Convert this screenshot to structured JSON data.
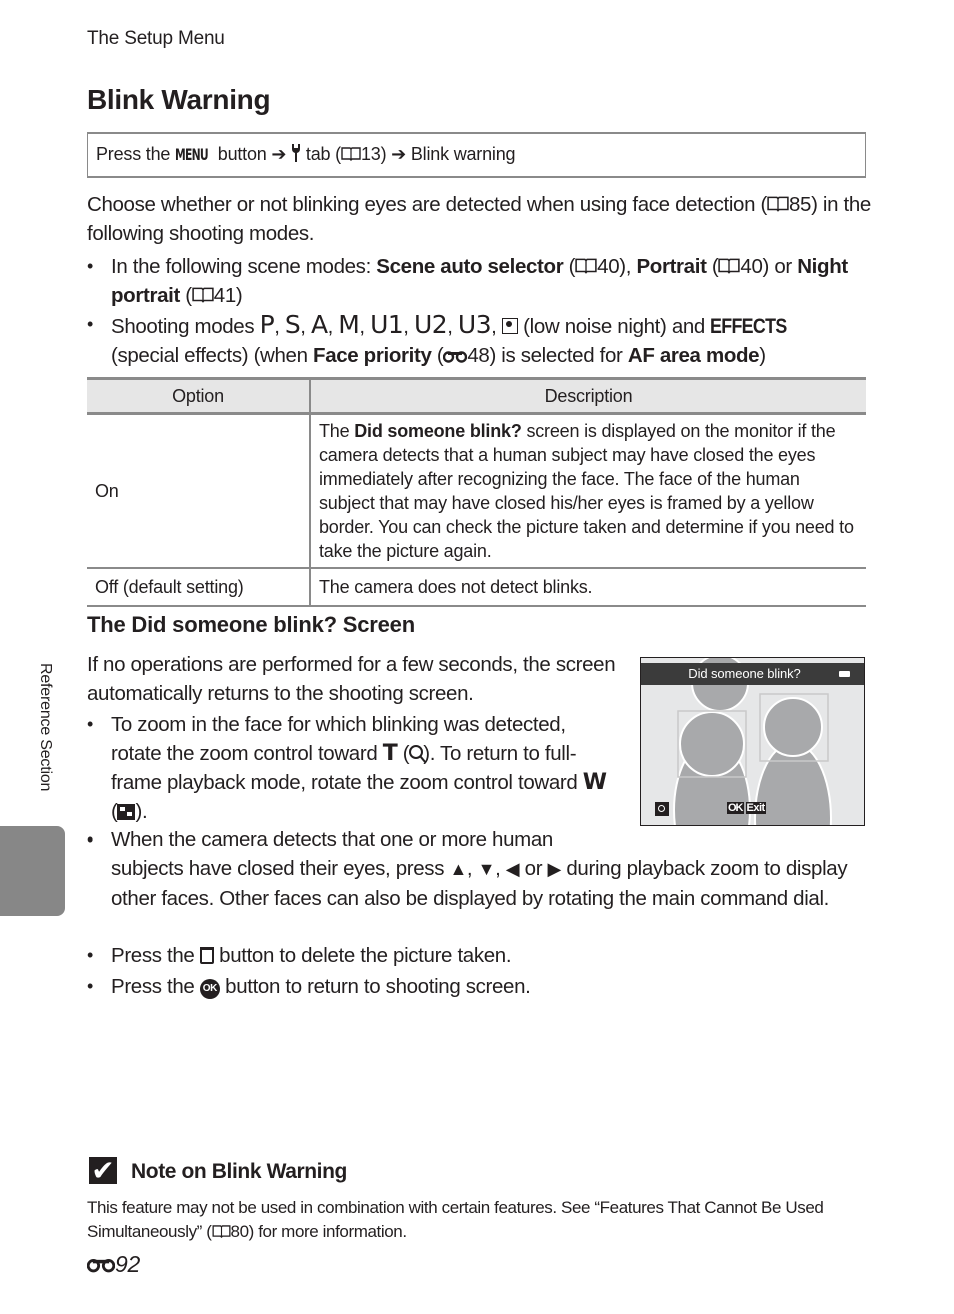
{
  "header": {
    "running_head": "The Setup Menu",
    "title": "Blink Warning"
  },
  "nav_path": {
    "press_the": "Press the ",
    "menu_button": "MENU",
    "button_text": " button ",
    "arrow": "➔",
    "tab_text": " tab (",
    "tab_page": "13",
    "close_paren": ") ",
    "destination": "Blink warning",
    "setup_icon": "wrench-icon",
    "book_icon": "book-icon"
  },
  "intro": {
    "text_before": "Choose whether or not blinking eyes are detected when using face detection (",
    "page_ref": "85",
    "text_after": ") in the following shooting modes."
  },
  "bullets_modes": [
    {
      "prefix": "In the following scene modes: ",
      "item1": "Scene auto selector",
      "ref1": "40",
      "mid": ", ",
      "item2": "Portrait",
      "ref2": "40",
      "or": " or",
      "item3": "Night portrait",
      "ref3": "41"
    },
    {
      "prefix": "Shooting modes ",
      "modes": [
        "P",
        "S",
        "A",
        "M",
        "U1",
        "U2",
        "U3"
      ],
      "low_noise_text": " (low noise night) and ",
      "effects_label": "EFFECTS",
      "special_text": "(special effects) (when ",
      "face_priority": "Face priority",
      "ref_page": "48",
      "selected_text": " is selected for ",
      "af_area_mode": "AF area mode"
    }
  ],
  "table": {
    "headers": [
      "Option",
      "Description"
    ],
    "rows": [
      {
        "option": "On",
        "desc_prefix": "The ",
        "desc_bold": "Did someone blink?",
        "desc_rest": " screen is displayed on the monitor if the camera detects that a human subject may have closed the eyes immediately after recognizing the face. The face of the human subject that may have closed his/her eyes is framed by a yellow border. You can check the picture taken and determine if you need to take the picture again."
      },
      {
        "option": "Off (default setting)",
        "desc_rest": "The camera does not detect blinks."
      }
    ]
  },
  "screen_section": {
    "heading": "The Did someone blink? Screen",
    "paragraph": "If no operations are performed for a few seconds, the screen automatically returns to the shooting screen.",
    "bullet_zoom": {
      "part1": "To zoom in the face for which blinking was detected, rotate the zoom control toward ",
      "t_letter": "T",
      "part2": " (",
      "part3": "). To return to full-frame playback mode, rotate the zoom control toward ",
      "w_letter": "W",
      "part4": " (",
      "part5": ")."
    },
    "bullet_faces": {
      "part1": "When the camera detects that one or more human subjects have closed their eyes, press ",
      "up": "▲",
      "sep1": ", ",
      "down": "▼",
      "sep2": ", ",
      "left": "◀",
      "or": " or ",
      "right": "▶",
      "part2": " during playback zoom to display other faces. Other faces can also be displayed by rotating the main command dial."
    },
    "bullet_delete": {
      "prefix": "Press the ",
      "suffix": " button to delete the picture taken."
    },
    "bullet_ok": {
      "prefix": "Press the ",
      "ok": "OK",
      "suffix": " button to return to shooting screen."
    }
  },
  "camera_screen": {
    "title": "Did someone blink?",
    "ok_label": "OK",
    "exit_label": "Exit"
  },
  "side_tab": {
    "label": "Reference Section"
  },
  "note": {
    "check": "✔",
    "title": "Note on Blink Warning",
    "body_before": "This feature may not be used in combination with certain features. See “Features That Cannot Be Used Simultaneously” (",
    "page_ref": "80",
    "body_after": ") for more information."
  },
  "footer": {
    "ref_icon": "⚯",
    "page_number": "92"
  },
  "colors": {
    "text": "#231f20",
    "rule_gray": "#8a8a8a",
    "table_header_bg": "#e6e6e6",
    "side_tab": "#878787",
    "camera_bg": "#e6e7e8",
    "camera_title_bar": "#3b3b3b",
    "figure_gray": "#a8a9ab"
  }
}
